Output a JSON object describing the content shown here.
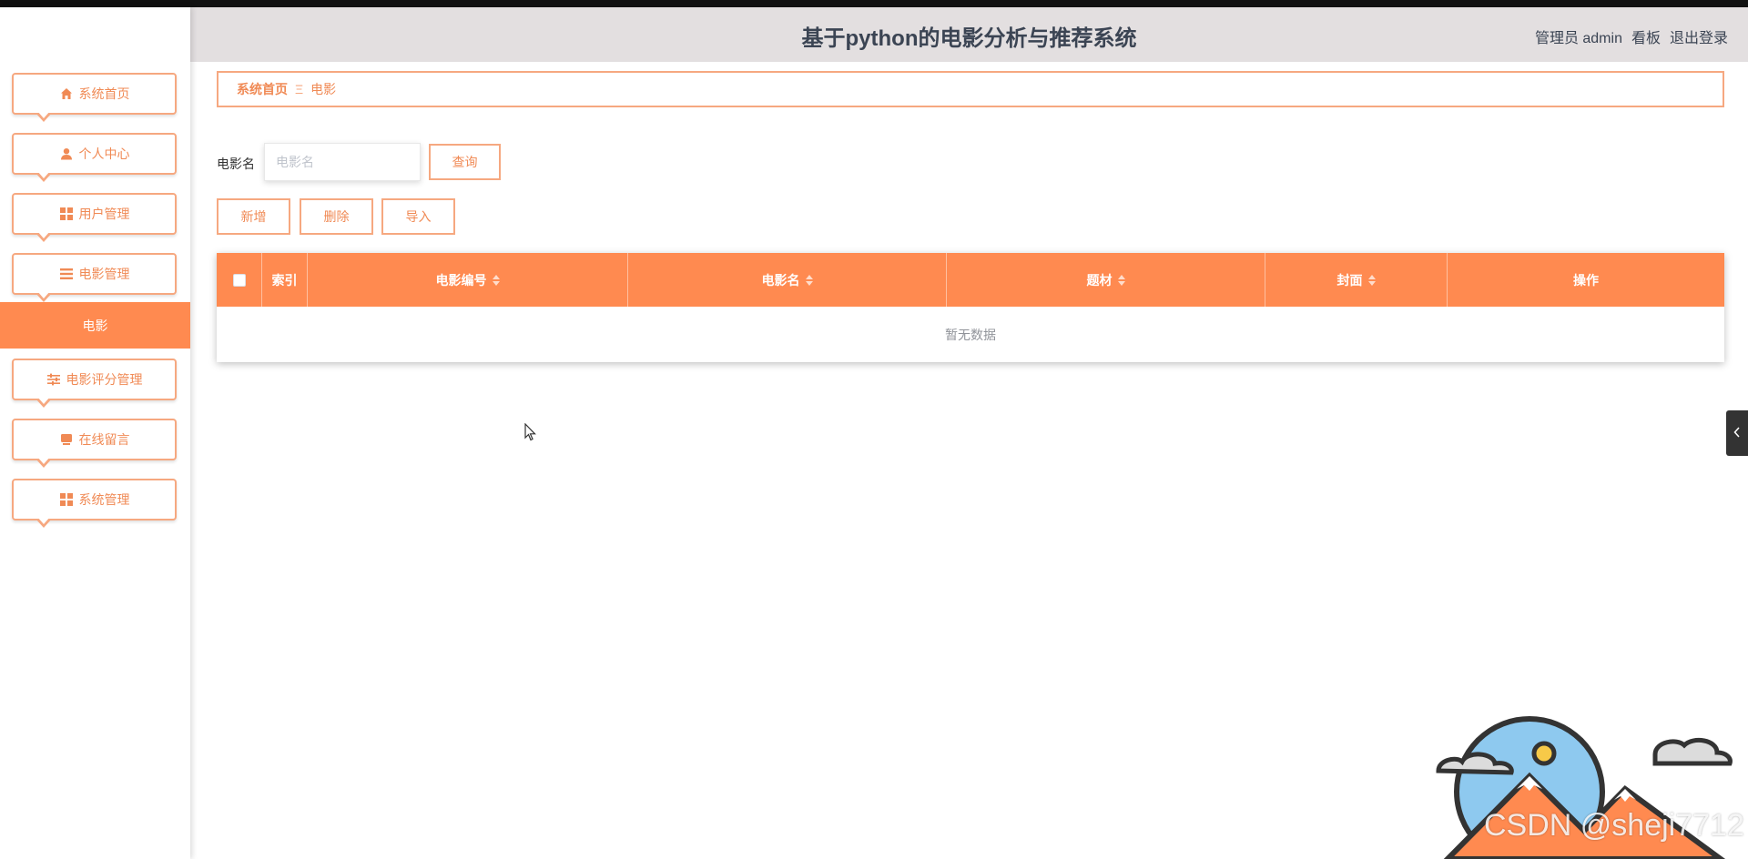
{
  "header": {
    "title": "基于python的电影分析与推荐系统",
    "user": "管理员 admin",
    "dashboard_link": "看板",
    "logout_link": "退出登录"
  },
  "sidebar": {
    "items": [
      {
        "label": "系统首页",
        "icon": "home-icon"
      },
      {
        "label": "个人中心",
        "icon": "user-icon"
      },
      {
        "label": "用户管理",
        "icon": "grid-icon"
      },
      {
        "label": "电影管理",
        "icon": "list-icon"
      },
      {
        "label": "电影评分管理",
        "icon": "sliders-icon"
      },
      {
        "label": "在线留言",
        "icon": "message-icon"
      },
      {
        "label": "系统管理",
        "icon": "grid-icon"
      }
    ],
    "active_sub": "电影"
  },
  "breadcrumb": {
    "home": "系统首页",
    "separator": "Ξ",
    "current": "电影"
  },
  "search": {
    "label": "电影名",
    "placeholder": "电影名",
    "query_button": "查询"
  },
  "actions": {
    "add": "新增",
    "delete": "删除",
    "import": "导入"
  },
  "table": {
    "columns": [
      "索引",
      "电影编号",
      "电影名",
      "题材",
      "封面",
      "操作"
    ],
    "empty_text": "暂无数据"
  },
  "watermark": "CSDN @sheji7712",
  "colors": {
    "accent": "#ff8a50",
    "border": "#f6a880",
    "header_bg": "#e3dfe0",
    "title": "#3b4453"
  }
}
